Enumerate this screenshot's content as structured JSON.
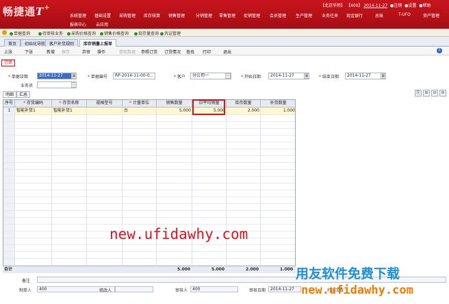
{
  "app": {
    "logo_prefix": "畅捷通",
    "logo_t": "T",
    "logo_plus": "+",
    "status": {
      "org": "【北京华邦】",
      "user": "【400】",
      "date": "2014-11-27",
      "logout": "注销",
      "settings": "设置",
      "help": "帮助"
    },
    "menu_row1": [
      "系统管理",
      "基础设置",
      "采购管理",
      "库存核算",
      "销售管理",
      "分销管理",
      "零售管理",
      "促销管理",
      "会员管理",
      "生产管理",
      "业务往来",
      "现金银行",
      "总账",
      "T-UFO",
      "资产管理"
    ],
    "menu_row2": [
      "报表中心",
      "云应用"
    ]
  },
  "quickbar": [
    "单据查询",
    "待审核业务",
    "采购价格查询",
    "销售价格查询",
    "现存量查询",
    "凭证管理"
  ],
  "tabs": [
    "首页",
    "初始化导航",
    "客户补货规则",
    "库存销量上报单"
  ],
  "toolbar": {
    "buttons": [
      "上张",
      "下张",
      "新增",
      "保存",
      "弃审",
      "操作",
      "提取数据",
      "参照订货",
      "订货情况",
      "查找",
      "打印",
      "退出"
    ],
    "disabled": [
      "保存",
      "提取数据"
    ],
    "help": "?"
  },
  "status_stamp": "已审",
  "form": {
    "doc_date_label": "单据日期",
    "doc_date": "2014-11-27",
    "doc_no_label": "单据编号",
    "doc_no": "RP-2014-11-00-0...",
    "customer_label": "客户",
    "customer": "分公司一",
    "start_label": "开始日期",
    "start": "2014-11-27",
    "end_label": "结束日期",
    "end": "2014-11-27",
    "salesman_label": "业务员",
    "salesman": ""
  },
  "subtabs": [
    "明细",
    "汇总"
  ],
  "grid": {
    "headers": [
      "序号",
      "存货编码",
      "存货名称",
      "规格型号",
      "计量单位",
      "销售数量",
      "日平均销量",
      "库存数量",
      "补货数量"
    ],
    "required": [
      "存货编码",
      "存货名称",
      "计量单位"
    ],
    "rows": [
      [
        "1",
        "智能补货1",
        "智能补货1",
        "",
        "台",
        "5.000",
        "5.000",
        "2.000",
        "1.000"
      ]
    ],
    "totals_label": "合计",
    "totals": [
      "5.000",
      "5.000",
      "2.000",
      "1.000"
    ]
  },
  "footer": {
    "remark_label": "备注",
    "maker_label": "制单人",
    "maker": "400",
    "modifier_label": "修改人",
    "modifier": "",
    "auditor_label": "审核人",
    "auditor": "400",
    "audit_date_label": "审核日期",
    "audit_date": "2014-11-27",
    "print_label": "打印次数"
  },
  "watermark": "new.ufidawhy.com",
  "brand_cn": "用友软件免费下载",
  "brand_url_a": "new",
  "brand_url_dot1": ".",
  "brand_url_b": "ufidawhy",
  "brand_url_dot2": ".",
  "brand_url_c": "com",
  "colors": {
    "header_red": "#c9151d",
    "highlight": "#d6141d",
    "accent_blue": "#3a6ec9"
  }
}
